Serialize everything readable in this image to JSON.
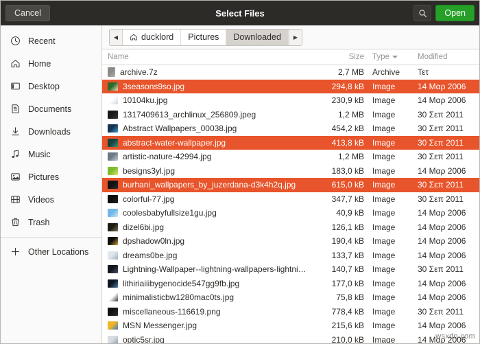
{
  "header": {
    "title": "Select Files",
    "cancel_label": "Cancel",
    "open_label": "Open",
    "search_icon": "search-icon",
    "accent_green": "#26a028",
    "bar_bg": "#2c2b28"
  },
  "sidebar": {
    "items": [
      {
        "label": "Recent",
        "icon": "clock-icon"
      },
      {
        "label": "Home",
        "icon": "home-icon"
      },
      {
        "label": "Desktop",
        "icon": "desktop-icon"
      },
      {
        "label": "Documents",
        "icon": "document-icon"
      },
      {
        "label": "Downloads",
        "icon": "download-icon"
      },
      {
        "label": "Music",
        "icon": "music-note-icon"
      },
      {
        "label": "Pictures",
        "icon": "image-icon"
      },
      {
        "label": "Videos",
        "icon": "video-icon"
      },
      {
        "label": "Trash",
        "icon": "trash-icon"
      },
      {
        "label": "Other Locations",
        "icon": "plus-icon"
      }
    ]
  },
  "pathbar": {
    "back_glyph": "◀",
    "forward_glyph": "▶",
    "crumbs": [
      {
        "label": "ducklord",
        "icon": "home-icon",
        "active": false
      },
      {
        "label": "Pictures",
        "icon": "",
        "active": false
      },
      {
        "label": "Downloaded",
        "icon": "",
        "active": true
      }
    ]
  },
  "columns": {
    "name": "Name",
    "size": "Size",
    "type": "Type",
    "modified": "Modified",
    "sorted_by": "Type",
    "sort_direction": "descending"
  },
  "selection_color": "#e8542b",
  "files": [
    {
      "name": "archive.7z",
      "size": "2,7 MB",
      "type": "Archive",
      "modified": "Τετ",
      "selected": false,
      "icon": "archive-file-icon",
      "c1": "#8e8b87",
      "c2": "#b5b2ae"
    },
    {
      "name": "3seasons9so.jpg",
      "size": "294,8 kB",
      "type": "Image",
      "modified": "14 Μαρ 2006",
      "selected": true,
      "icon": "image-thumbnail",
      "c1": "#2f6a2a",
      "c2": "#e8e2c8"
    },
    {
      "name": "10104ku.jpg",
      "size": "230,9 kB",
      "type": "Image",
      "modified": "14 Μαρ 2006",
      "selected": false,
      "icon": "image-thumbnail",
      "c1": "#ffffff",
      "c2": "#cfd6de"
    },
    {
      "name": "1317409613_archlinux_256809.jpeg",
      "size": "1,2 MB",
      "type": "Image",
      "modified": "30 Σεπ 2011",
      "selected": false,
      "icon": "image-thumbnail",
      "c1": "#1a1a1a",
      "c2": "#3a3a3a"
    },
    {
      "name": "Abstract Wallpapers_00038.jpg",
      "size": "454,2 kB",
      "type": "Image",
      "modified": "30 Σεπ 2011",
      "selected": false,
      "icon": "image-thumbnail",
      "c1": "#16344f",
      "c2": "#3d9bd6"
    },
    {
      "name": "abstract-water-wallpaper.jpg",
      "size": "413,8 kB",
      "type": "Image",
      "modified": "30 Σεπ 2011",
      "selected": true,
      "icon": "image-thumbnail",
      "c1": "#14443c",
      "c2": "#3e8f7e"
    },
    {
      "name": "artistic-nature-42994.jpg",
      "size": "1,2 MB",
      "type": "Image",
      "modified": "30 Σεπ 2011",
      "selected": false,
      "icon": "image-thumbnail",
      "c1": "#6c7a86",
      "c2": "#c3ccd4"
    },
    {
      "name": "besigns3yl.jpg",
      "size": "183,0 kB",
      "type": "Image",
      "modified": "14 Μαρ 2006",
      "selected": false,
      "icon": "image-thumbnail",
      "c1": "#7dbb2e",
      "c2": "#d6e86a"
    },
    {
      "name": "burhani_wallpapers_by_juzerdana-d3k4h2q.jpg",
      "size": "615,0 kB",
      "type": "Image",
      "modified": "30 Σεπ 2011",
      "selected": true,
      "icon": "image-thumbnail",
      "c1": "#121212",
      "c2": "#2b2b2b"
    },
    {
      "name": "colorful-77.jpg",
      "size": "347,7 kB",
      "type": "Image",
      "modified": "30 Σεπ 2011",
      "selected": false,
      "icon": "image-thumbnail",
      "c1": "#0d0d0d",
      "c2": "#242424"
    },
    {
      "name": "coolesbabyfullsize1gu.jpg",
      "size": "40,9 kB",
      "type": "Image",
      "modified": "14 Μαρ 2006",
      "selected": false,
      "icon": "image-thumbnail",
      "c1": "#6fb7e8",
      "c2": "#cfe9f8"
    },
    {
      "name": "dizel6bi.jpg",
      "size": "126,1 kB",
      "type": "Image",
      "modified": "14 Μαρ 2006",
      "selected": false,
      "icon": "image-thumbnail",
      "c1": "#1c1c14",
      "c2": "#7a7050"
    },
    {
      "name": "dpshadow0ln.jpg",
      "size": "190,4 kB",
      "type": "Image",
      "modified": "14 Μαρ 2006",
      "selected": false,
      "icon": "image-thumbnail",
      "c1": "#100e0c",
      "c2": "#d6a437"
    },
    {
      "name": "dreams0be.jpg",
      "size": "133,7 kB",
      "type": "Image",
      "modified": "14 Μαρ 2006",
      "selected": false,
      "icon": "image-thumbnail",
      "c1": "#dfe6ec",
      "c2": "#9fb3c4"
    },
    {
      "name": "Lightning-Wallpaper--lightning-wallpapers-lightni…",
      "size": "140,7 kB",
      "type": "Image",
      "modified": "30 Σεπ 2011",
      "selected": false,
      "icon": "image-thumbnail",
      "c1": "#13161c",
      "c2": "#45506b"
    },
    {
      "name": "lithiriaiiibygenocide547gg9fb.jpg",
      "size": "177,0 kB",
      "type": "Image",
      "modified": "14 Μαρ 2006",
      "selected": false,
      "icon": "image-thumbnail",
      "c1": "#0f1620",
      "c2": "#4c7ea8"
    },
    {
      "name": "minimalisticbw1280mac0ts.jpg",
      "size": "75,8 kB",
      "type": "Image",
      "modified": "14 Μαρ 2006",
      "selected": false,
      "icon": "image-thumbnail",
      "c1": "#ffffff",
      "c2": "#3c3c3c"
    },
    {
      "name": "miscellaneous-116619.png",
      "size": "778,4 kB",
      "type": "Image",
      "modified": "30 Σεπ 2011",
      "selected": false,
      "icon": "image-thumbnail",
      "c1": "#121212",
      "c2": "#303030"
    },
    {
      "name": "MSN Messenger.jpg",
      "size": "215,6 kB",
      "type": "Image",
      "modified": "14 Μαρ 2006",
      "selected": false,
      "icon": "image-thumbnail",
      "c1": "#f0b429",
      "c2": "#3e7fc1"
    },
    {
      "name": "optic5sr.jpg",
      "size": "210,0 kB",
      "type": "Image",
      "modified": "14 Μαρ 2006",
      "selected": false,
      "icon": "image-thumbnail",
      "c1": "#d8dde2",
      "c2": "#8fa3b4"
    }
  ],
  "watermark": "wsxdn.com"
}
